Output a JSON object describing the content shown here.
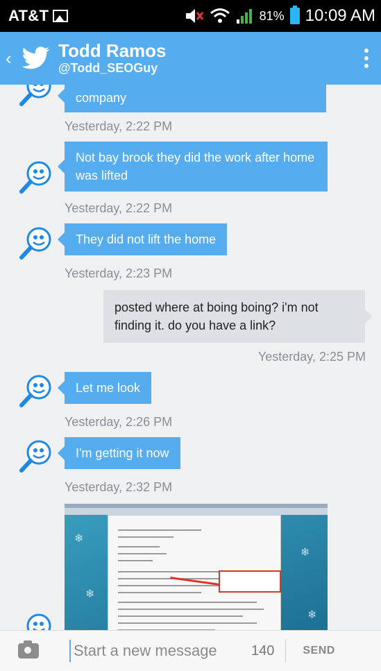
{
  "status_bar": {
    "carrier": "AT&T",
    "battery": "81%",
    "time": "10:09 AM"
  },
  "header": {
    "name": "Todd Ramos",
    "handle": "@Todd_SEOGuy"
  },
  "messages": [
    {
      "dir": "in",
      "text": "company",
      "time": "Yesterday, 2:22 PM"
    },
    {
      "dir": "in",
      "text": "Not bay brook they did the work after home was lifted",
      "time": "Yesterday, 2:22 PM"
    },
    {
      "dir": "in",
      "text": "They did not lift the home",
      "time": "Yesterday, 2:23 PM"
    },
    {
      "dir": "out",
      "text": "posted where at boing boing? i'm not finding it. do you have a link?",
      "time": "Yesterday, 2:25 PM"
    },
    {
      "dir": "in",
      "text": "Let me look",
      "time": "Yesterday, 2:26 PM"
    },
    {
      "dir": "in",
      "text": "I'm getting it now",
      "time": "Yesterday, 2:32 PM"
    }
  ],
  "composer": {
    "placeholder": "Start a new message",
    "count": "140",
    "send_label": "SEND"
  },
  "icons": {
    "back": "chevron-left-icon",
    "logo": "twitter-bird-icon",
    "overflow": "overflow-menu-icon",
    "avatar": "magnifier-smiley-avatar",
    "camera": "camera-icon"
  },
  "colors": {
    "accent": "#55acee",
    "outgoing_bubble": "#dde0e4",
    "timestamp": "#8a8f94"
  }
}
